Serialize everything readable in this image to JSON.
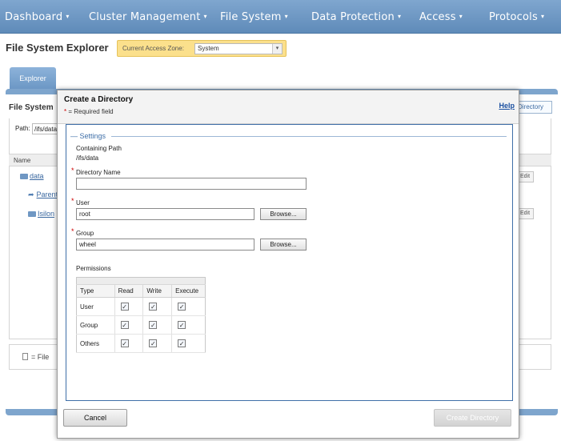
{
  "nav": {
    "items": [
      {
        "label": "Dashboard",
        "caret": "▾"
      },
      {
        "label": "Cluster Management",
        "caret": "▾"
      },
      {
        "label": "File System",
        "caret": "▾"
      },
      {
        "label": "Data Protection",
        "caret": "▾"
      },
      {
        "label": "Access",
        "caret": "▾"
      },
      {
        "label": "Protocols",
        "caret": "▾"
      }
    ]
  },
  "page": {
    "title": "File System Explorer",
    "access_zone_label": "Current Access Zone:",
    "access_zone_value": "System",
    "tab_explorer": "Explorer"
  },
  "background": {
    "section_title": "File System",
    "create_dir_button": "Directory",
    "path_label": "Path:",
    "path_value": "/ifs/data",
    "column_name": "Name",
    "rows": [
      {
        "label": "data"
      },
      {
        "label": "Parent"
      },
      {
        "label": "Isilon"
      }
    ],
    "edit_label": "Edit",
    "legend_text": "= File"
  },
  "dialog": {
    "title": "Create a Directory",
    "required_star": "*",
    "required_note": "= Required field",
    "help_link": "Help",
    "settings_legend": "— Settings",
    "containing_path_label": "Containing Path",
    "containing_path_value": "/ifs/data",
    "directory_name_label": "Directory Name",
    "directory_name_value": "",
    "user_label": "User",
    "user_value": "root",
    "group_label": "Group",
    "group_value": "wheel",
    "browse_label": "Browse...",
    "permissions_label": "Permissions",
    "permissions": {
      "columns": [
        "Type",
        "Read",
        "Write",
        "Execute"
      ],
      "rows": [
        {
          "type": "User",
          "read": true,
          "write": true,
          "execute": true
        },
        {
          "type": "Group",
          "read": true,
          "write": true,
          "execute": true
        },
        {
          "type": "Others",
          "read": true,
          "write": true,
          "execute": true
        }
      ],
      "check_glyph": "✓"
    },
    "cancel_button": "Cancel",
    "create_button": "Create Directory"
  },
  "colors": {
    "nav_bg": "#6f97c3",
    "zone_bg": "#fbe08c",
    "dialog_border": "#3f6fa8",
    "required": "#cc0000"
  }
}
